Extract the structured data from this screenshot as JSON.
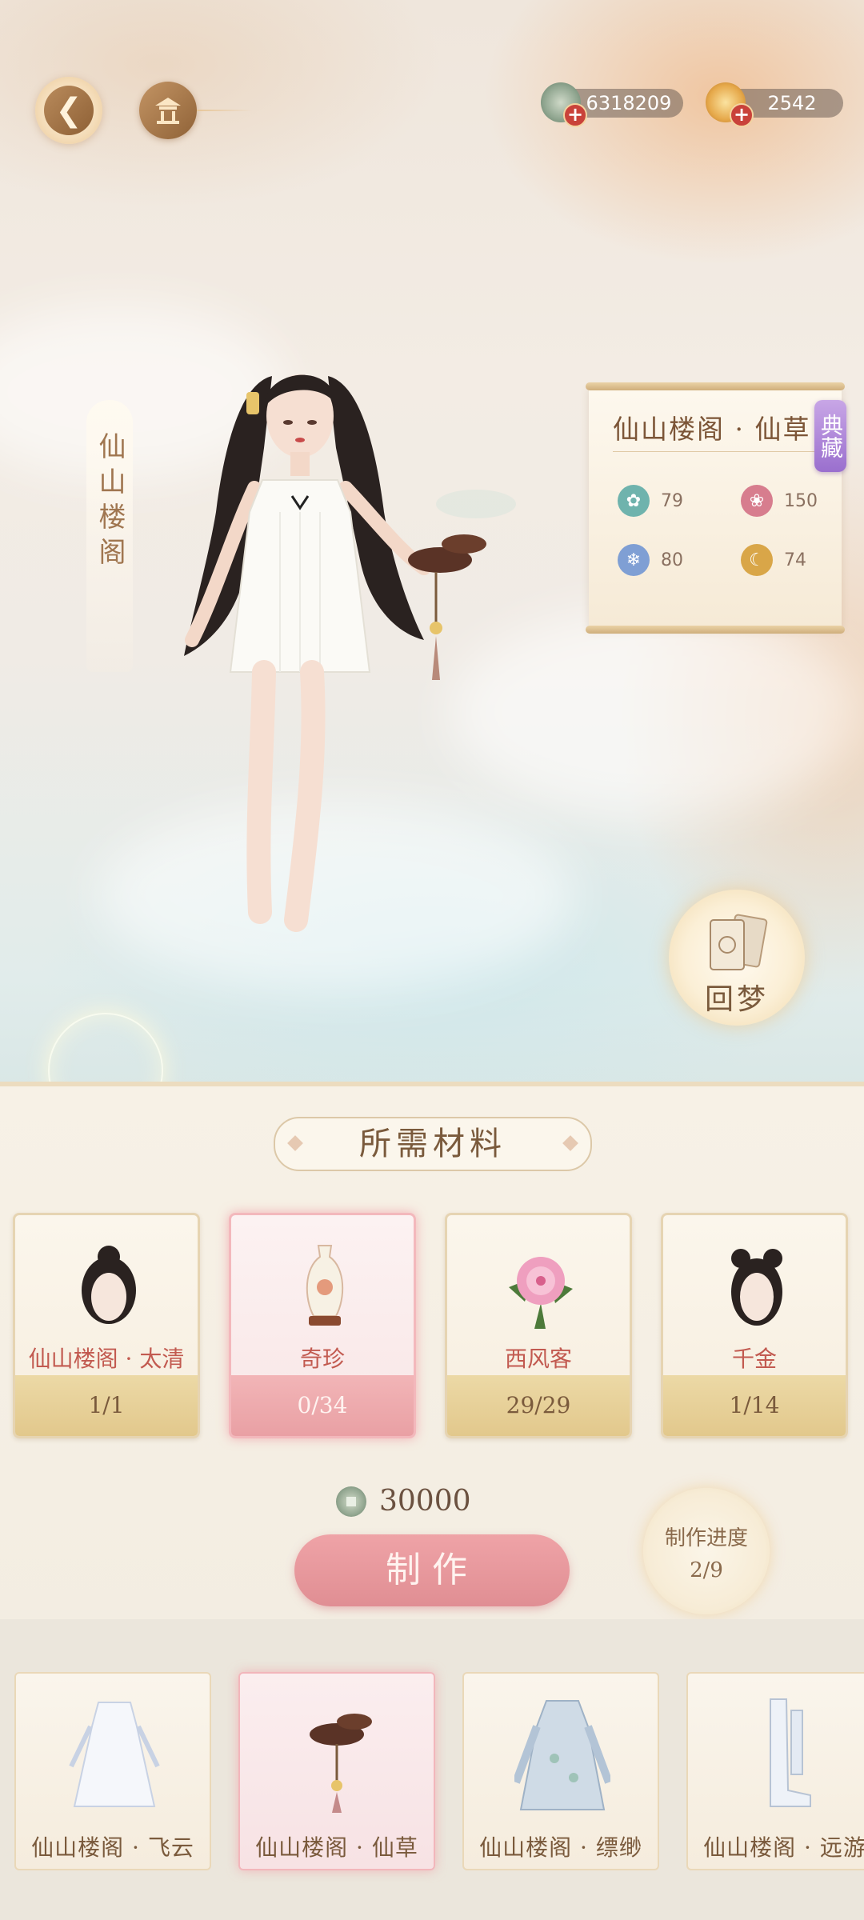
{
  "currency": {
    "coins": "6318209",
    "gold": "2542",
    "plus": "+"
  },
  "suit_vertical_title": "仙山楼阁",
  "info_panel": {
    "title": "仙山楼阁 · 仙草",
    "badge": "典藏",
    "stats": [
      {
        "icon": "teal-swirl-icon",
        "value": "79",
        "color": "#6fb3ad"
      },
      {
        "icon": "pink-lotus-icon",
        "value": "150",
        "color": "#d77d8e"
      },
      {
        "icon": "blue-snowflake-icon",
        "value": "80",
        "color": "#7f9fd4"
      },
      {
        "icon": "gold-moon-icon",
        "value": "74",
        "color": "#d9a648"
      }
    ]
  },
  "dream_button": "回梦",
  "materials": {
    "title": "所需材料",
    "items": [
      {
        "name": "仙山楼阁 · 太清",
        "count": "1/1",
        "icon": "hairstyle-bun-icon",
        "selected": false
      },
      {
        "name": "奇珍",
        "count": "0/34",
        "icon": "porcelain-vase-icon",
        "selected": true
      },
      {
        "name": "西风客",
        "count": "29/29",
        "icon": "pink-flower-icon",
        "selected": false
      },
      {
        "name": "千金",
        "count": "1/14",
        "icon": "hairstyle-buns-icon",
        "selected": false
      }
    ]
  },
  "cost": "30000",
  "make_button": "制作",
  "progress": {
    "label": "制作进度",
    "value": "2/9"
  },
  "outfits": [
    {
      "name": "仙山楼阁 · 飞云",
      "icon": "white-dress-icon",
      "selected": false
    },
    {
      "name": "仙山楼阁 · 仙草",
      "icon": "lingzhi-accessory-icon",
      "selected": true
    },
    {
      "name": "仙山楼阁 · 缥缈",
      "icon": "blue-robe-icon",
      "selected": false
    },
    {
      "name": "仙山楼阁 · 远游",
      "icon": "white-boots-icon",
      "selected": false
    }
  ],
  "colors": {
    "accent_pink": "#e08e93",
    "text_brown": "#7a5a3c",
    "material_name_red": "#c25a50",
    "badge_purple": "#9a6fce"
  }
}
